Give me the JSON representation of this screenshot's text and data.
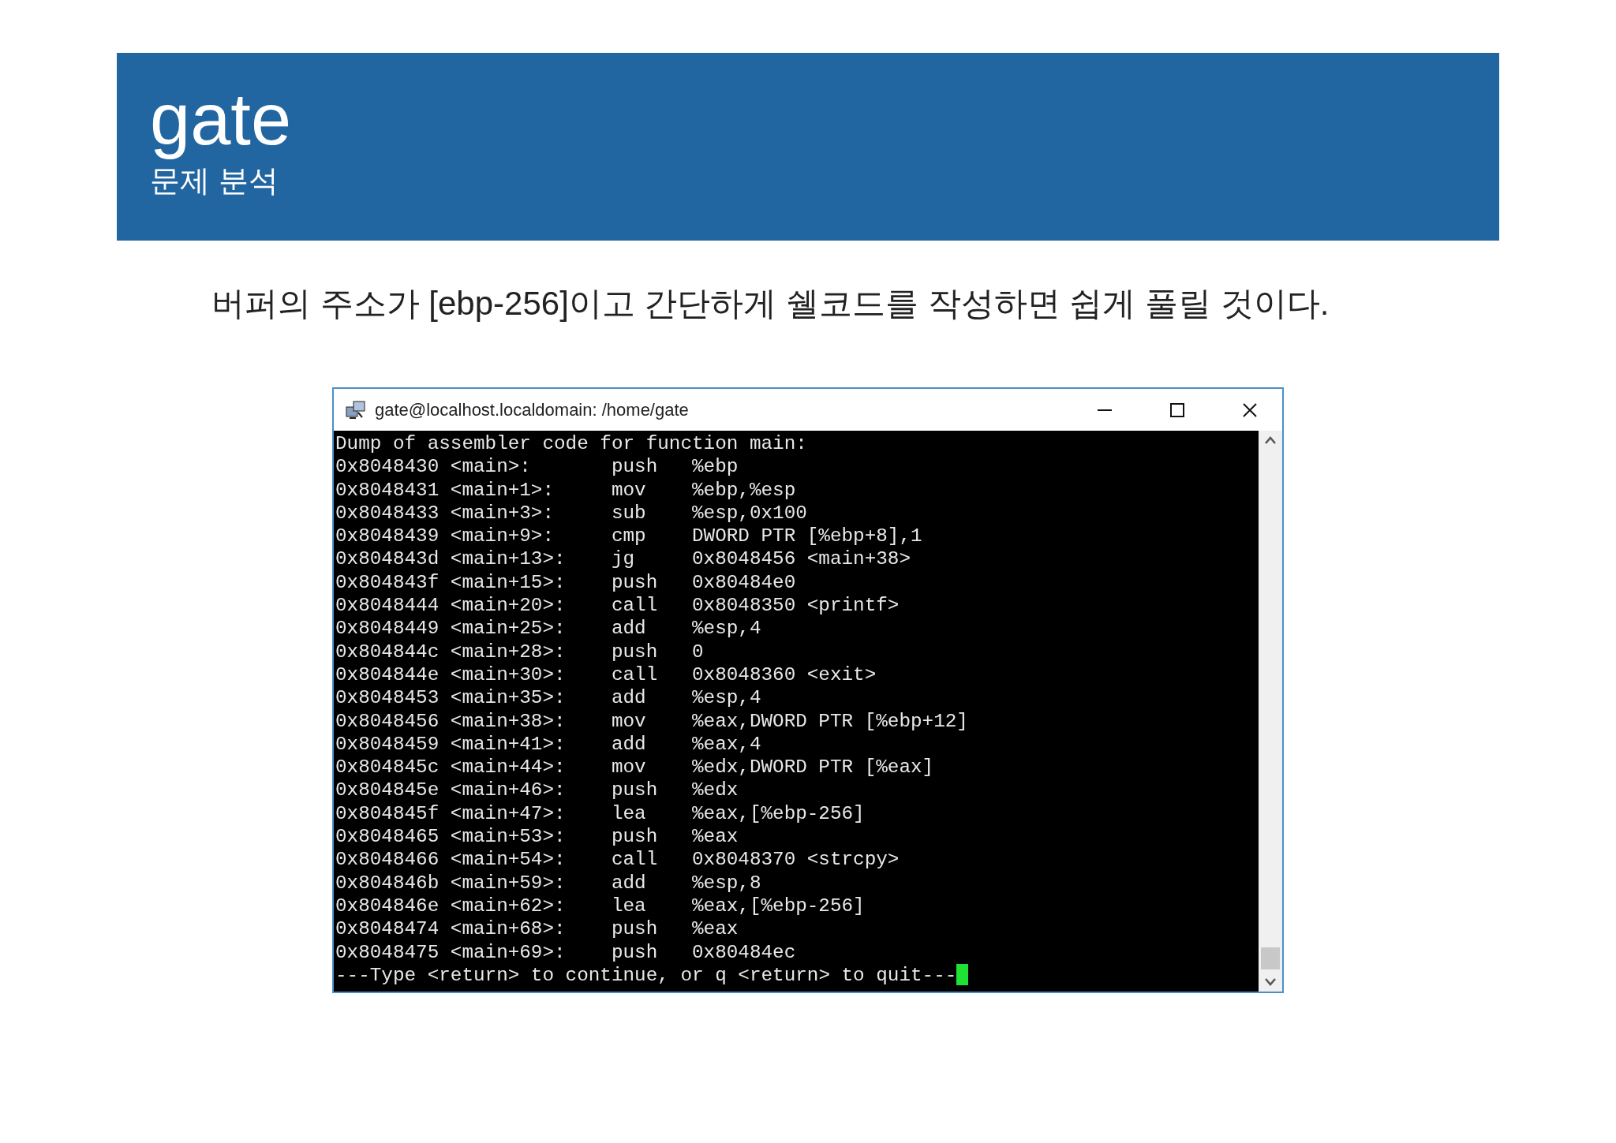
{
  "header": {
    "title": "gate",
    "subtitle": "문제 분석"
  },
  "description": "버퍼의 주소가 [ebp-256]이고 간단하게 쉘코드를 작성하면 쉽게 풀릴 것이다.",
  "terminal": {
    "title": "gate@localhost.localdomain: /home/gate",
    "heading": "Dump of assembler code for function main:",
    "rows": [
      {
        "location": "0x8048430 <main>:",
        "mnemonic": "push",
        "operand": "%ebp"
      },
      {
        "location": "0x8048431 <main+1>:",
        "mnemonic": "mov",
        "operand": "%ebp,%esp"
      },
      {
        "location": "0x8048433 <main+3>:",
        "mnemonic": "sub",
        "operand": "%esp,0x100"
      },
      {
        "location": "0x8048439 <main+9>:",
        "mnemonic": "cmp",
        "operand": "DWORD PTR [%ebp+8],1"
      },
      {
        "location": "0x804843d <main+13>:",
        "mnemonic": "jg",
        "operand": "0x8048456 <main+38>"
      },
      {
        "location": "0x804843f <main+15>:",
        "mnemonic": "push",
        "operand": "0x80484e0"
      },
      {
        "location": "0x8048444 <main+20>:",
        "mnemonic": "call",
        "operand": "0x8048350 <printf>"
      },
      {
        "location": "0x8048449 <main+25>:",
        "mnemonic": "add",
        "operand": "%esp,4"
      },
      {
        "location": "0x804844c <main+28>:",
        "mnemonic": "push",
        "operand": "0"
      },
      {
        "location": "0x804844e <main+30>:",
        "mnemonic": "call",
        "operand": "0x8048360 <exit>"
      },
      {
        "location": "0x8048453 <main+35>:",
        "mnemonic": "add",
        "operand": "%esp,4"
      },
      {
        "location": "0x8048456 <main+38>:",
        "mnemonic": "mov",
        "operand": "%eax,DWORD PTR [%ebp+12]"
      },
      {
        "location": "0x8048459 <main+41>:",
        "mnemonic": "add",
        "operand": "%eax,4"
      },
      {
        "location": "0x804845c <main+44>:",
        "mnemonic": "mov",
        "operand": "%edx,DWORD PTR [%eax]"
      },
      {
        "location": "0x804845e <main+46>:",
        "mnemonic": "push",
        "operand": "%edx"
      },
      {
        "location": "0x804845f <main+47>:",
        "mnemonic": "lea",
        "operand": "%eax,[%ebp-256]"
      },
      {
        "location": "0x8048465 <main+53>:",
        "mnemonic": "push",
        "operand": "%eax"
      },
      {
        "location": "0x8048466 <main+54>:",
        "mnemonic": "call",
        "operand": "0x8048370 <strcpy>"
      },
      {
        "location": "0x804846b <main+59>:",
        "mnemonic": "add",
        "operand": "%esp,8"
      },
      {
        "location": "0x804846e <main+62>:",
        "mnemonic": "lea",
        "operand": "%eax,[%ebp-256]"
      },
      {
        "location": "0x8048474 <main+68>:",
        "mnemonic": "push",
        "operand": "%eax"
      },
      {
        "location": "0x8048475 <main+69>:",
        "mnemonic": "push",
        "operand": "0x80484ec"
      }
    ],
    "prompt": "---Type <return> to continue, or q <return> to quit---"
  }
}
